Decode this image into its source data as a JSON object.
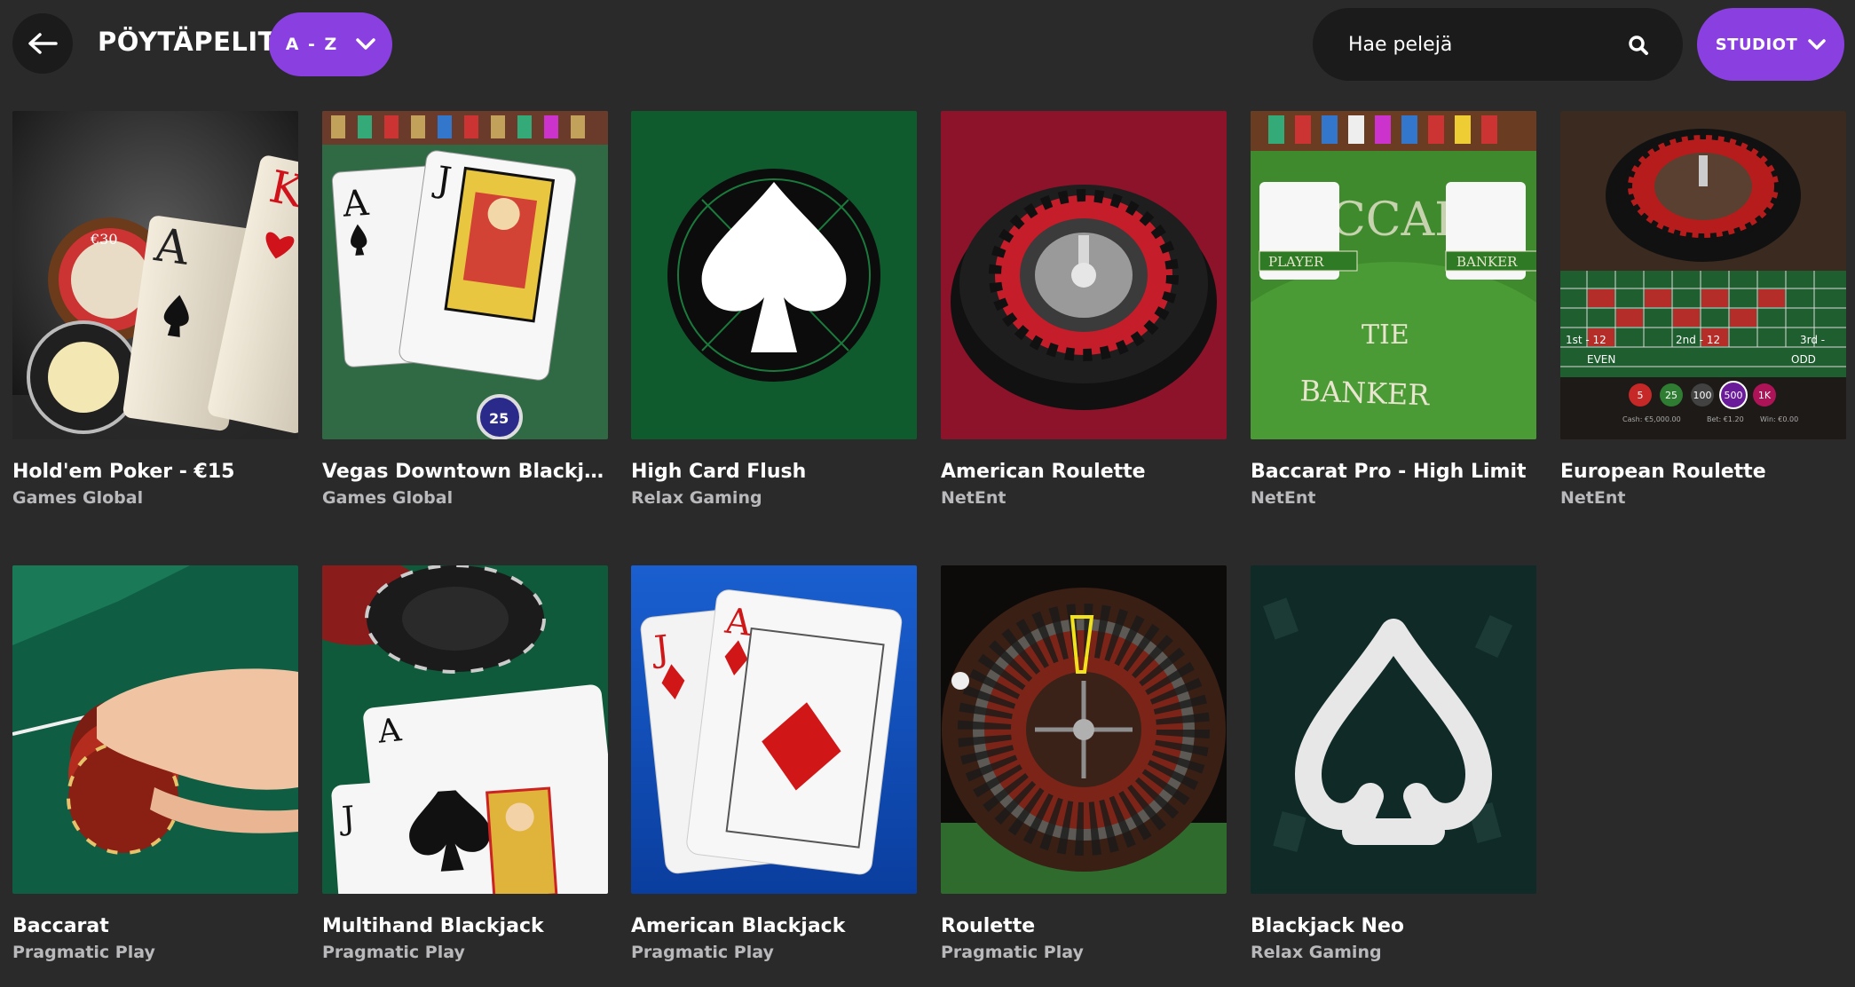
{
  "header": {
    "title": "PÖYTÄPELIT",
    "sort_label": "A - Z",
    "search_placeholder": "Hae pelejä",
    "studios_label": "STUDIOT"
  },
  "colors": {
    "background": "#2a2a2b",
    "accent": "#8a3fe0",
    "dark_pill": "#1b1b1c",
    "studio_text": "#b9b9bc"
  },
  "games": [
    {
      "title": "Hold'em Poker - €15",
      "studio": "Games Global",
      "art": "holdem"
    },
    {
      "title": "Vegas Downtown Blackjack ...",
      "studio": "Games Global",
      "art": "vegas-blackjack"
    },
    {
      "title": "High Card Flush",
      "studio": "Relax Gaming",
      "art": "spade-emblem"
    },
    {
      "title": "American Roulette",
      "studio": "NetEnt",
      "art": "roulette-red"
    },
    {
      "title": "Baccarat Pro - High Limit",
      "studio": "NetEnt",
      "art": "baccarat-table"
    },
    {
      "title": "European Roulette",
      "studio": "NetEnt",
      "art": "roulette-table"
    },
    {
      "title": "Baccarat",
      "studio": "Pragmatic Play",
      "art": "hand-chips"
    },
    {
      "title": "Multihand Blackjack",
      "studio": "Pragmatic Play",
      "art": "jack-spades"
    },
    {
      "title": "American Blackjack",
      "studio": "Pragmatic Play",
      "art": "diamond-cards"
    },
    {
      "title": "Roulette",
      "studio": "Pragmatic Play",
      "art": "roulette-wheel"
    },
    {
      "title": "Blackjack Neo",
      "studio": "Relax Gaming",
      "art": "spade-outline"
    }
  ],
  "card_text": {
    "ace": "A",
    "king": "K",
    "jack": "J",
    "chip25": "25",
    "chip30": "€30",
    "player": "PLAYER",
    "banker_tag": "BANKER",
    "tie": "TIE",
    "banker": "BANKER",
    "even": "EVEN",
    "odd": "ODD",
    "st12": "1st - 12",
    "nd12": "2nd - 12",
    "rd12": "3rd -",
    "chips": [
      "5",
      "25",
      "100",
      "500",
      "1K"
    ],
    "cash": "Cash: €5,000.00",
    "bet": "Bet: €1.20",
    "win": "Win: €0.00",
    "ccar": "CCAR"
  }
}
